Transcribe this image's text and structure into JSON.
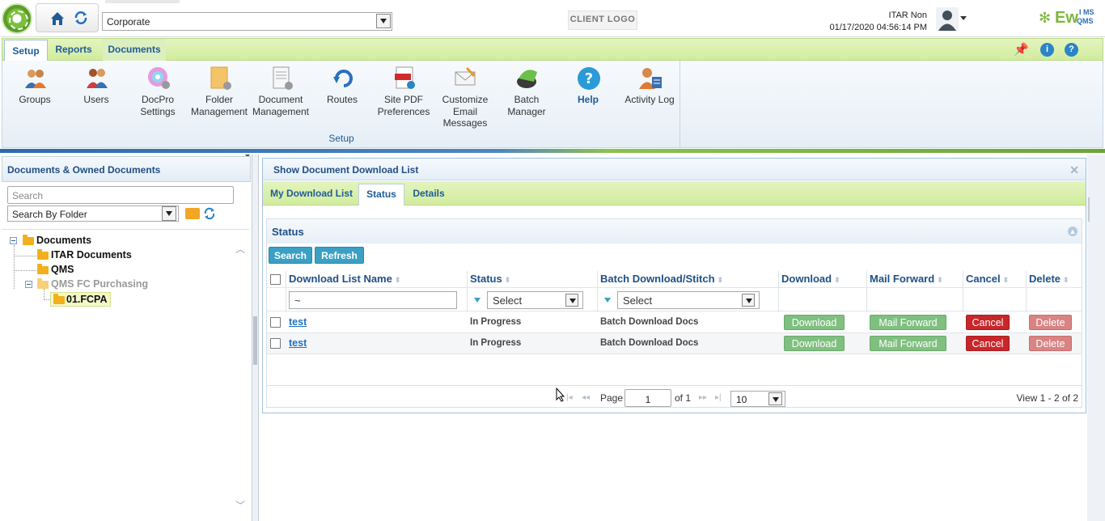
{
  "header": {
    "organization": "Corporate",
    "client_logo": "CLIENT LOGO",
    "user_name": "ITAR Non",
    "datetime": "01/17/2020 04:56:14 PM",
    "brand_text": "Ew",
    "brand_sub1": "I MS",
    "brand_sub2": "QMS"
  },
  "ribbon": {
    "tabs": [
      "Setup",
      "Reports",
      "Documents"
    ],
    "buttons": [
      {
        "label": "Groups",
        "icon": "groups-icon"
      },
      {
        "label": "Users",
        "icon": "users-icon"
      },
      {
        "label": "DocPro Settings",
        "icon": "docpro-settings-icon"
      },
      {
        "label": "Folder Management",
        "icon": "folder-management-icon"
      },
      {
        "label": "Document Management",
        "icon": "document-management-icon"
      },
      {
        "label": "Routes",
        "icon": "routes-icon"
      },
      {
        "label": "Site PDF Preferences",
        "icon": "pdf-preferences-icon"
      },
      {
        "label": "Customize Email Messages",
        "icon": "email-messages-icon"
      },
      {
        "label": "Batch Manager",
        "icon": "batch-manager-icon"
      },
      {
        "label": "Help",
        "icon": "help-icon"
      },
      {
        "label": "Activity Log",
        "icon": "activity-log-icon"
      }
    ],
    "group_label": "Setup",
    "right_icons": [
      "pin-icon",
      "info-icon",
      "help-icon"
    ]
  },
  "left": {
    "title": "Documents & Owned Documents",
    "search_placeholder": "Search",
    "search_by": "Search By Folder",
    "tree": {
      "root": "Documents",
      "items": [
        "ITAR Documents",
        "QMS",
        "QMS FC Purchasing"
      ],
      "sub": "01.FCPA"
    }
  },
  "main": {
    "title": "Show Document Download List",
    "tabs": [
      "My Download List",
      "Status",
      "Details"
    ],
    "active_tab": "Status",
    "section_title": "Status",
    "toolbar": {
      "search": "Search",
      "refresh": "Refresh"
    },
    "columns": [
      "Download List Name",
      "Status",
      "Batch Download/Stitch",
      "Download",
      "Mail Forward",
      "Cancel",
      "Delete"
    ],
    "filter": {
      "name": "~",
      "status": "Select",
      "batch": "Select"
    },
    "rows": [
      {
        "name": "test",
        "status": "In Progress",
        "batch": "Batch Download Docs",
        "download": "Download",
        "mail": "Mail Forward",
        "cancel": "Cancel",
        "delete": "Delete"
      },
      {
        "name": "test",
        "status": "In Progress",
        "batch": "Batch Download Docs",
        "download": "Download",
        "mail": "Mail Forward",
        "cancel": "Cancel",
        "delete": "Delete"
      }
    ],
    "pager": {
      "page_label": "Page",
      "page": "1",
      "of": "of 1",
      "size": "10",
      "view": "View 1 - 2 of 2"
    }
  },
  "colors": {
    "accent_green": "#d1ec9d",
    "link_blue": "#1f72c4",
    "cancel_red": "#c8262a"
  }
}
